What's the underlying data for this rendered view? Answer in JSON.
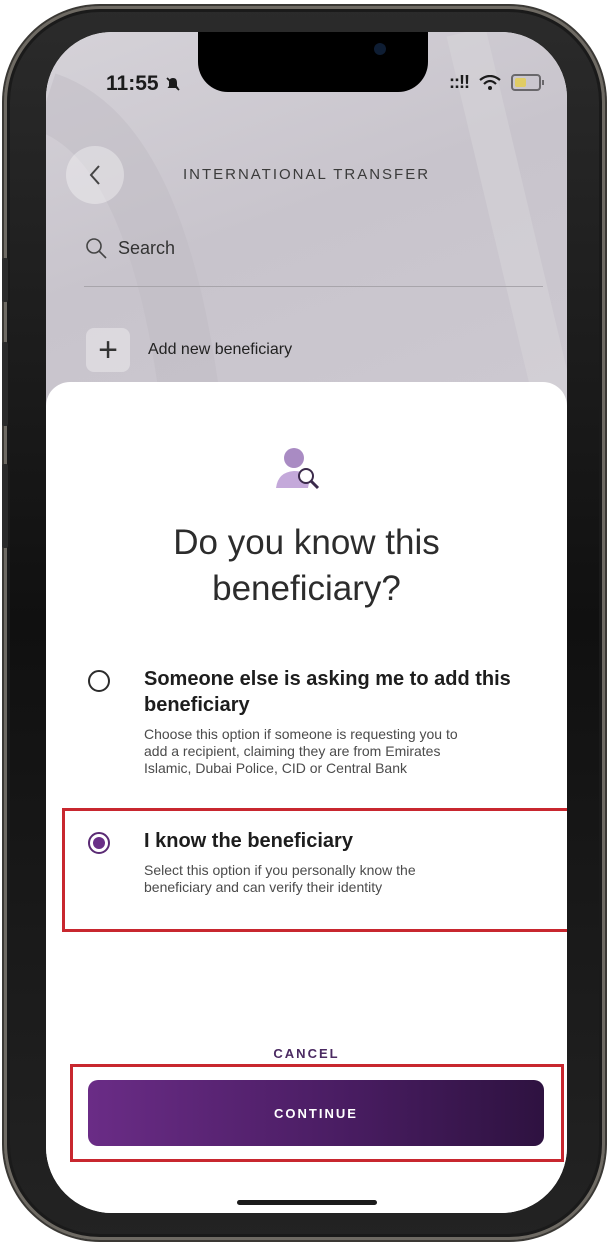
{
  "status_bar": {
    "time": "11:55",
    "mute_icon": "bell-slash-icon",
    "signal_text": "::!!",
    "wifi_icon": "wifi-icon",
    "battery_color": "#f3d10f"
  },
  "header": {
    "title": "INTERNATIONAL TRANSFER",
    "back_icon": "chevron-left-icon"
  },
  "search": {
    "placeholder": "Search"
  },
  "add_beneficiary": {
    "label": "Add new beneficiary"
  },
  "dialog": {
    "icon": "person-search-icon",
    "title_line1": "Do you know this",
    "title_line2": "beneficiary?",
    "options": [
      {
        "title_line1": "Someone else is asking me to add this",
        "title_line2": "beneficiary",
        "desc_line1": "Choose this option if someone is requesting you to",
        "desc_line2": "add a recipient, claiming they are from Emirates",
        "desc_line3": "Islamic, Dubai Police, CID or Central Bank",
        "selected": false
      },
      {
        "title_line1": "I know the beneficiary",
        "desc_line1": "Select this option if you personally know the",
        "desc_line2": "beneficiary and can verify their identity",
        "selected": true
      }
    ],
    "cancel_label": "CANCEL",
    "continue_label": "CONTINUE"
  },
  "colors": {
    "accent": "#6a2f87",
    "highlight": "#c8272f"
  }
}
